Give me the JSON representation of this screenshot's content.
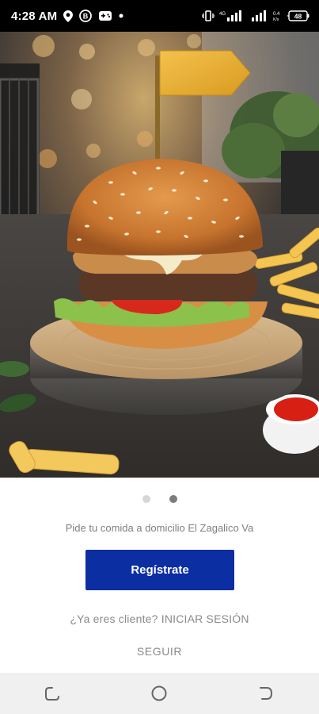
{
  "status_bar": {
    "time": "4:28 AM",
    "battery": "48"
  },
  "onboarding": {
    "hero_icons": [
      "location-pin-icon",
      "b-app-icon",
      "gamepad-icon",
      "dot-icon"
    ],
    "pager": {
      "total": 2,
      "active": 2
    },
    "tagline": "Pide tu comida a domicilio El Zagalico Va",
    "register_label": "Regístrate",
    "login_prompt": "¿Ya eres cliente?",
    "login_label": "INICIAR SESIÓN",
    "skip_label": "SEGUIR"
  },
  "colors": {
    "primary_button": "#0b2ea3",
    "muted_text": "#8a8a8a",
    "nav_bar": "#f0f0f0"
  },
  "nav_bar": {
    "icons": [
      "recent-apps-icon",
      "home-icon",
      "back-icon"
    ]
  }
}
